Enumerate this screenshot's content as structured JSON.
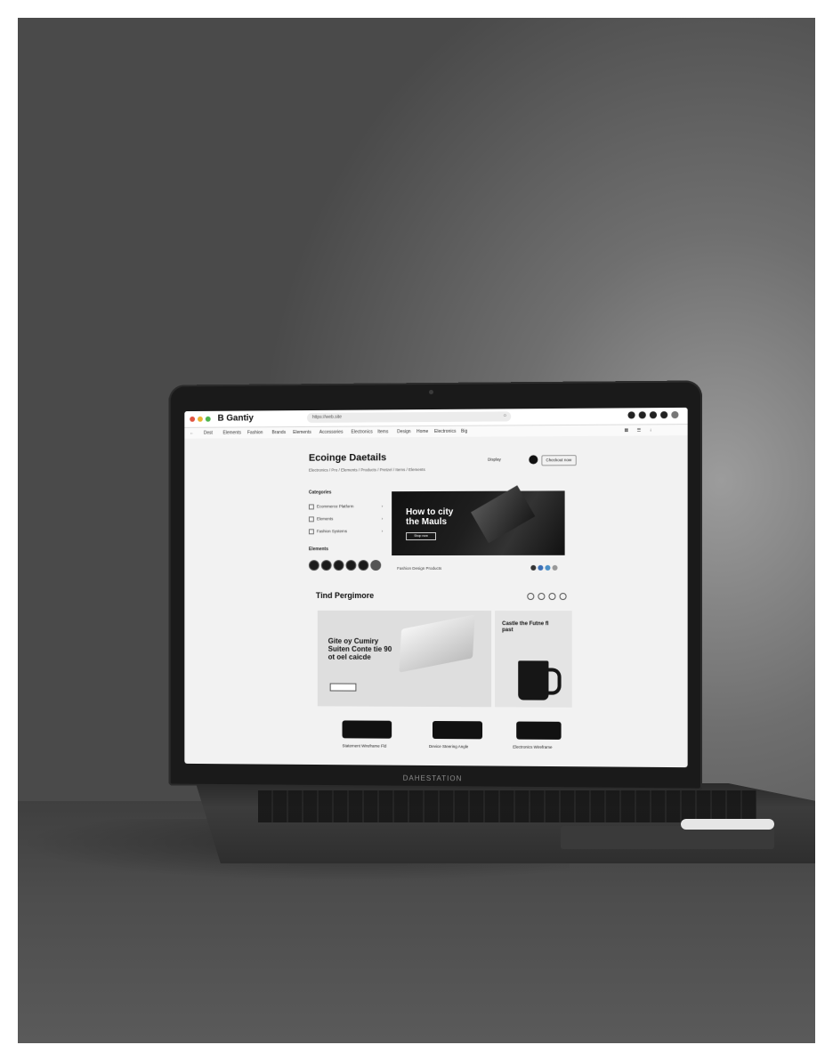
{
  "screen": {
    "brand": "B Gantiy",
    "address": "https://web.site",
    "nav": [
      "Dest",
      "Elements",
      "Fashion",
      "Brands",
      "Elements",
      "Accessories",
      "Electronics",
      "Items",
      "Design",
      "Home",
      "Electronics",
      "Big"
    ],
    "page_title": "Ecoinge Daetails",
    "breadcrumbs": "Electronics / Pro / Elements / Products / Pretzel / Items / Elements",
    "header_actions": [
      "Display",
      "Checkout now"
    ],
    "filters_title": "Categories",
    "filters": [
      "Ecommerce Platform",
      "Elements",
      "Fashion Systems"
    ],
    "swatches_title": "Elements",
    "hero": {
      "title": "How to city the Mauls",
      "button": "Shop now"
    },
    "hero_caption": "Fashion Design Products",
    "section_title": "Tind Pergimore",
    "card_large": {
      "title": "Gite oy Cumiry Suiten Conte tie 90 ot oel caicde",
      "button": "Shop"
    },
    "card_small": {
      "title": "Castle the Futne fl past"
    },
    "products": [
      "Statement Wireframe Fld",
      "Device Steering Angle",
      "Electronics Wireframe"
    ],
    "bezel_label": "DAHESTATION"
  }
}
